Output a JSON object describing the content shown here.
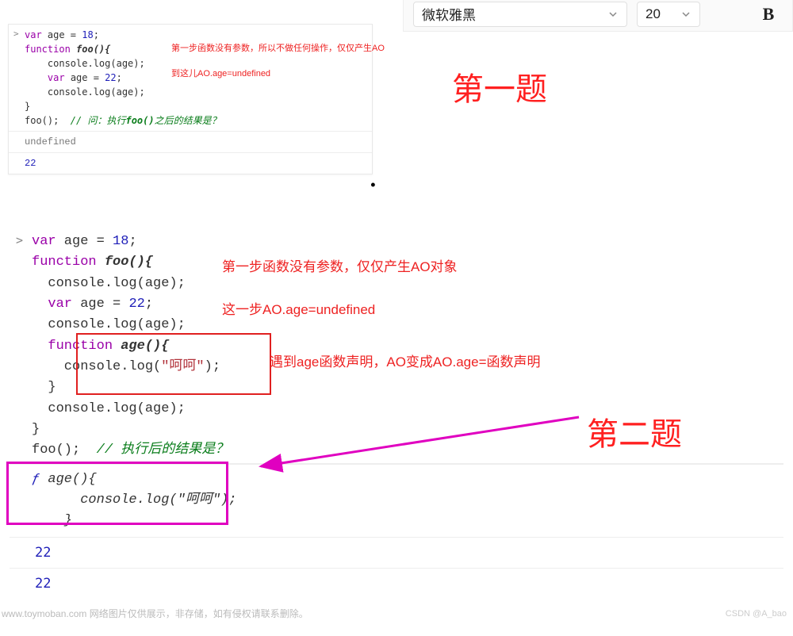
{
  "toolbar": {
    "font_selected": "微软雅黑",
    "size_selected": "20",
    "bold_label": "B"
  },
  "heading1": "第一题",
  "heading2": "第二题",
  "dot": "•",
  "block1": {
    "prompt": ">",
    "code_parts": {
      "l1a": "var",
      "l1b": " age = ",
      "l1c": "18",
      "l1d": ";",
      "l2a": "function",
      "l2b": " foo(){",
      "l3a": "    console.log(age);",
      "l4a": "    ",
      "l4b": "var",
      "l4c": " age = ",
      "l4d": "22",
      "l4e": ";",
      "l5a": "    console.log(age);",
      "l6a": "}",
      "l7a": "foo();  ",
      "l7b": "// 问：执行",
      "l7c": "foo()",
      "l7d": "之后的结果是？"
    },
    "anno1": "第一步函数没有参数，所以不做任何操作，仅仅产生AO",
    "anno2": "到这儿AO.age=undefined",
    "out1": "undefined",
    "out2": "22"
  },
  "block2": {
    "prompt": ">",
    "code_parts": {
      "l1a": "var",
      "l1b": " age = ",
      "l1c": "18",
      "l1d": ";",
      "l2a": "function",
      "l2b": " foo(){",
      "l3a": "  console.log(age);",
      "l4a": "  ",
      "l4b": "var",
      "l4c": " age = ",
      "l4d": "22",
      "l4e": ";",
      "l5a": "  console.log(age);",
      "l6a": "  ",
      "l6b": "function",
      "l6c": " age(){",
      "l7a": "    console.log(",
      "l7b": "\"呵呵\"",
      "l7c": ");",
      "l8a": "  }",
      "l9a": "  console.log(age);",
      "l10a": "}",
      "l11a": "foo();  ",
      "l11b": "// 执行后的结果是？"
    },
    "anno1": "第一步函数没有参数，仅仅产生AO对象",
    "anno2": "这一步AO.age=undefined",
    "anno3": "遇到age函数声明，AO变成AO.age=函数声明",
    "out_func_sym": "ƒ",
    "out_func": " age(){\n      console.log(\"呵呵\");\n    }",
    "out2": "22",
    "out3": "22"
  },
  "footer": "www.toymoban.com 网络图片仅供展示，非存储，如有侵权请联系删除。",
  "watermark": "CSDN @A_bao"
}
